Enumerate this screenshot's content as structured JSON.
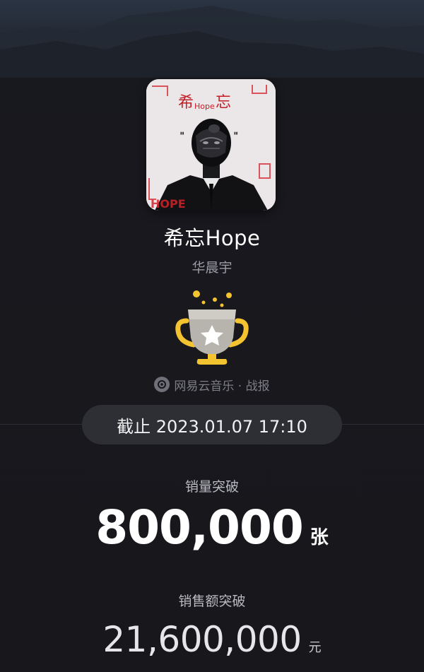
{
  "album": {
    "title": "希忘Hope",
    "artist": "华晨宇",
    "cover_text_top": "希Hope忘",
    "cover_text_bottom": "HOPE"
  },
  "source": {
    "label": "网易云音乐 · 战报"
  },
  "date_pill": {
    "text": "截止 2023.01.07 17:10"
  },
  "sales": {
    "label": "销量突破",
    "value": "800,000",
    "unit": "张"
  },
  "revenue": {
    "label": "销售额突破",
    "value": "21,600,000",
    "unit": "元"
  },
  "icons": {
    "trophy": "trophy-star-icon",
    "source_logo": "netease-music-logo-icon"
  },
  "colors": {
    "background": "#17171c",
    "pill": "#2e2e35",
    "accent_red": "#d6232b",
    "trophy_gold": "#f4c430"
  }
}
